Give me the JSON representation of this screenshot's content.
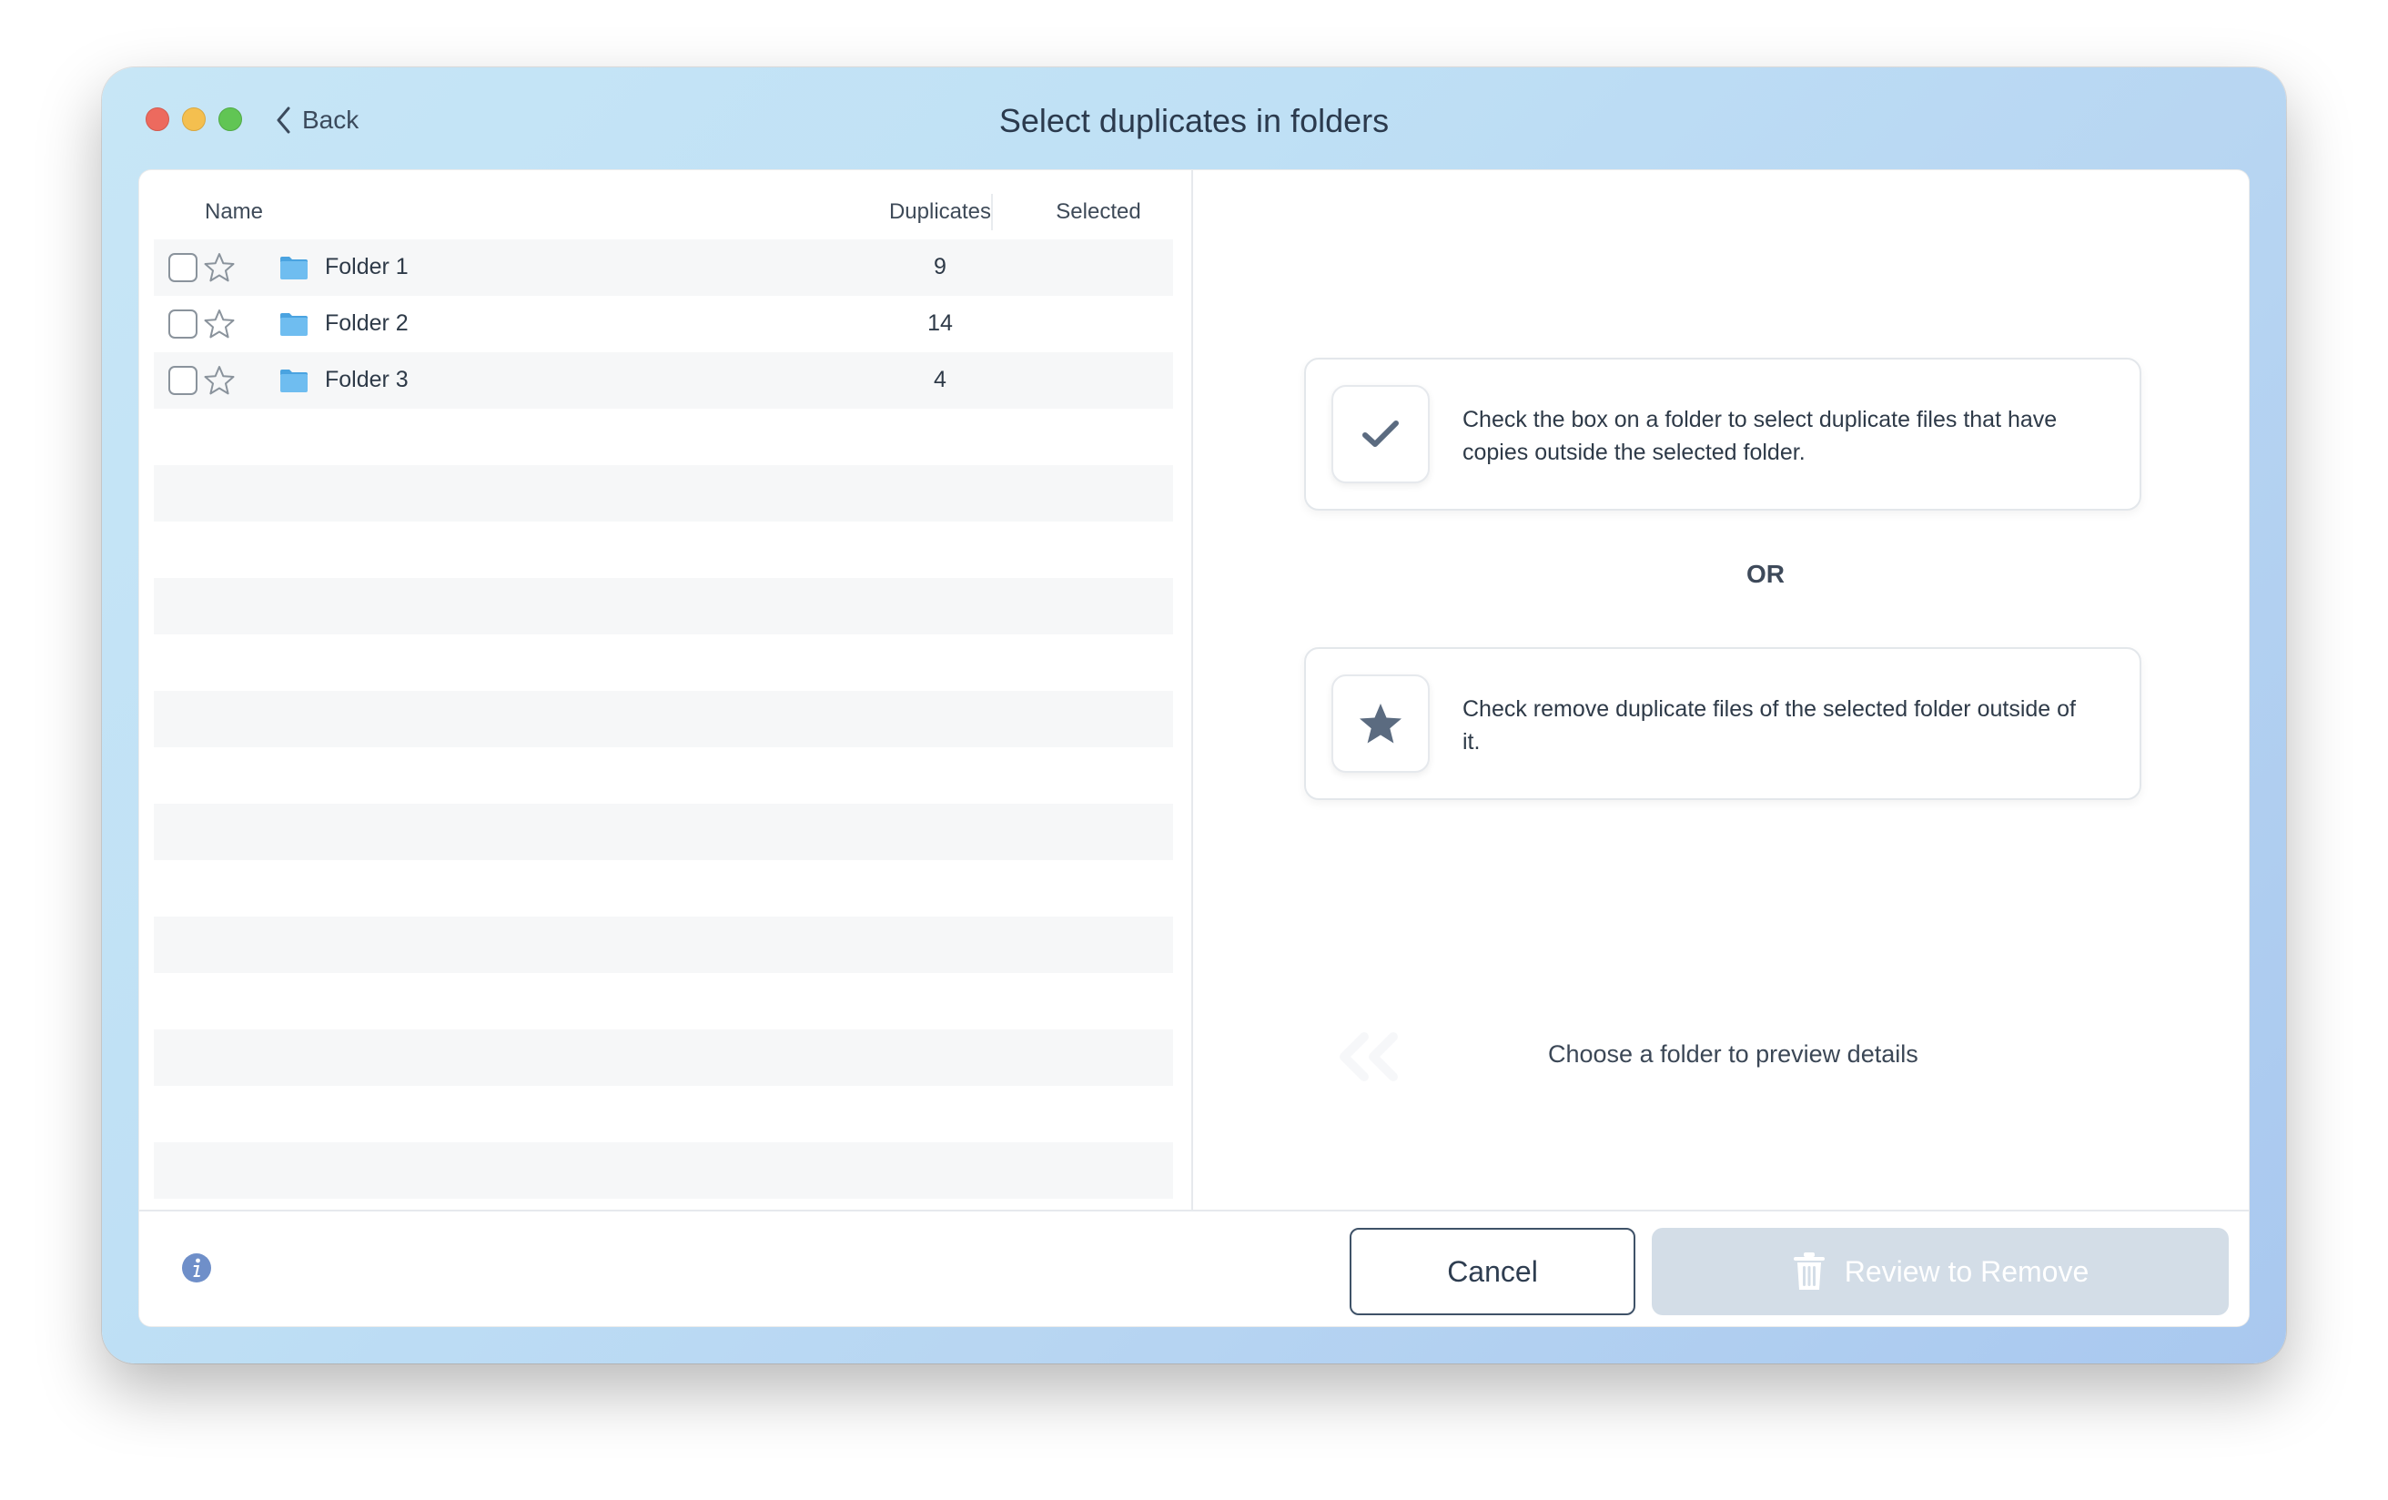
{
  "window": {
    "title": "Select duplicates in folders",
    "back_label": "Back"
  },
  "table": {
    "columns": {
      "name": "Name",
      "duplicates": "Duplicates",
      "selected": "Selected"
    },
    "rows": [
      {
        "name": "Folder 1",
        "duplicates": "9",
        "selected": "",
        "checked": false,
        "starred": false
      },
      {
        "name": "Folder 2",
        "duplicates": "14",
        "selected": "",
        "checked": false,
        "starred": false
      },
      {
        "name": "Folder 3",
        "duplicates": "4",
        "selected": "",
        "checked": false,
        "starred": false
      }
    ]
  },
  "hints": {
    "checkbox_hint": "Check the box on a folder to select duplicate files that have copies outside the selected folder.",
    "or_label": "OR",
    "star_hint": "Check remove duplicate files of the selected folder outside of it.",
    "preview_hint": "Choose a folder to preview details"
  },
  "footer": {
    "cancel_label": "Cancel",
    "review_label": "Review to Remove"
  },
  "icons": {
    "checkbox_hint_icon": "checkmark-icon",
    "star_hint_icon": "star-icon",
    "info": "info-icon",
    "trash": "trash-icon",
    "folder": "folder-icon"
  },
  "colors": {
    "accent_blue": "#6f8fc9",
    "folder_blue": "#5fb2ea",
    "disabled_button": "#d3dde7",
    "text_dark": "#2e3a48"
  }
}
